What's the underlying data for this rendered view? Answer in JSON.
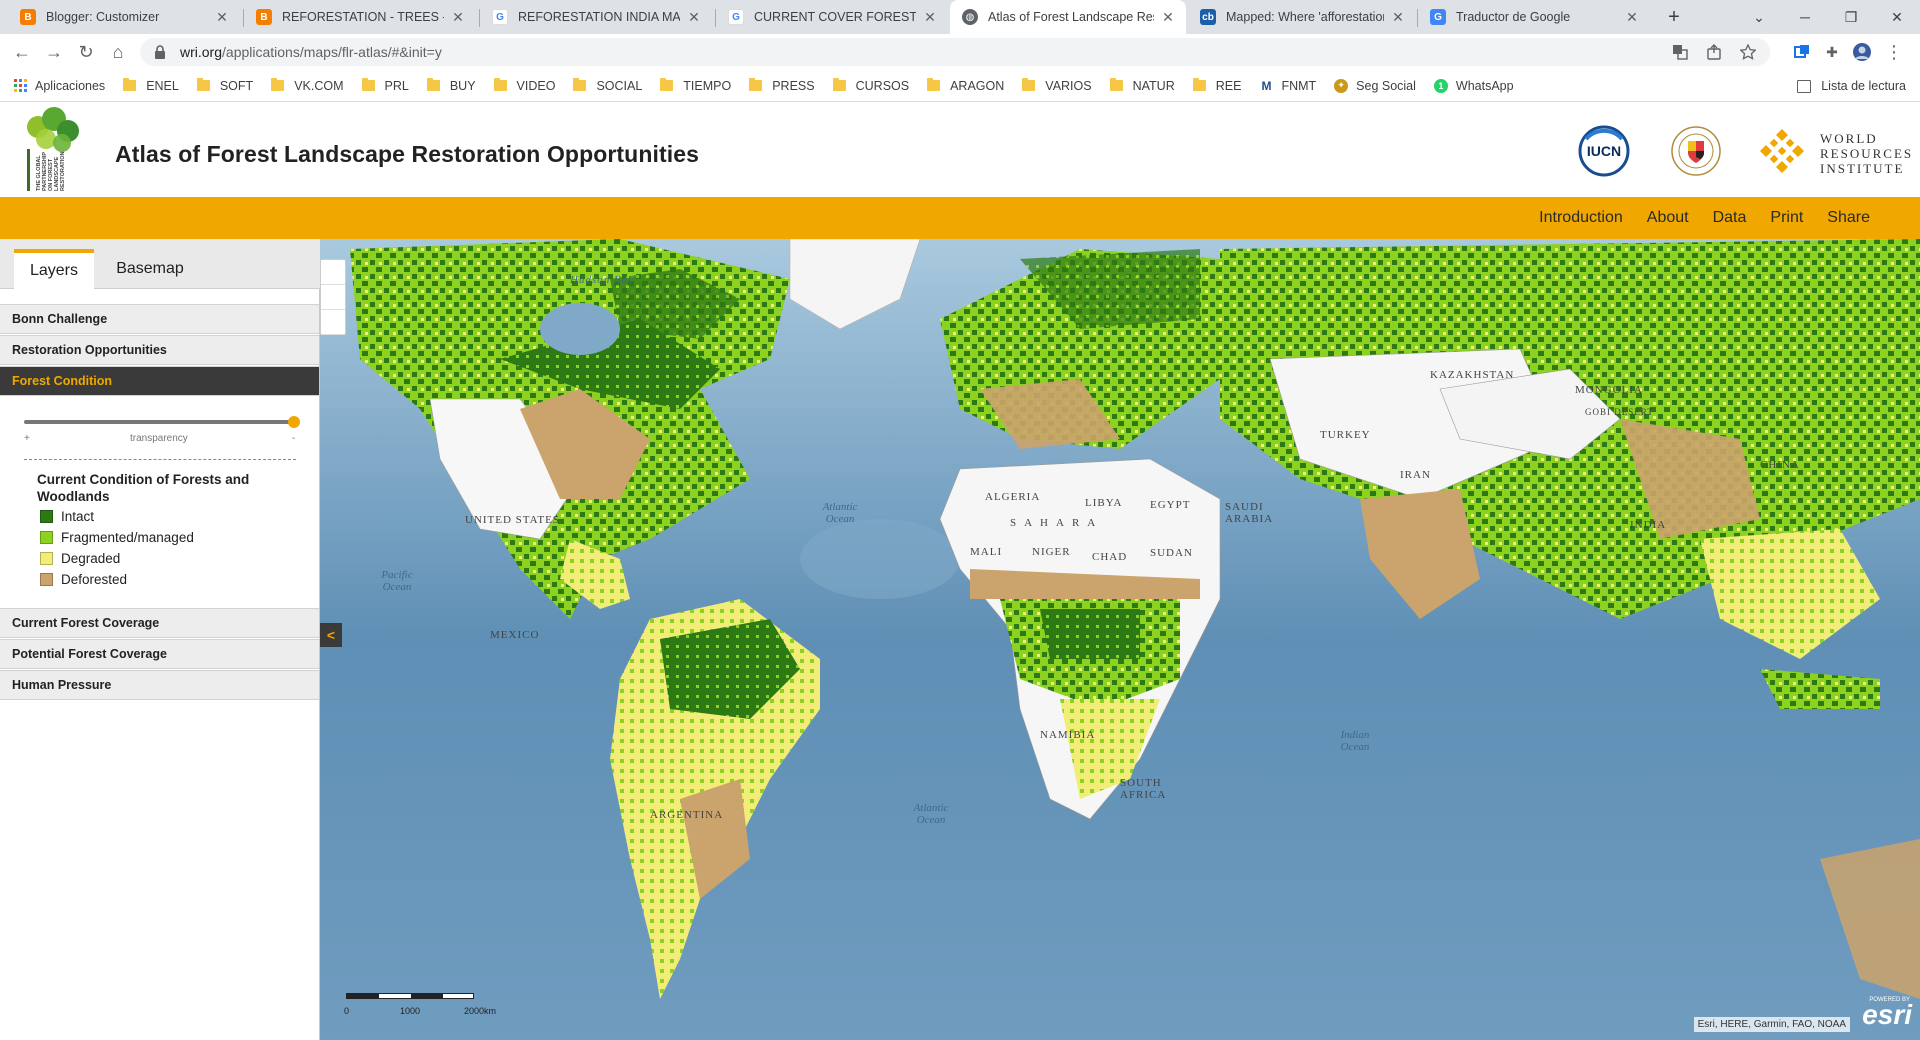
{
  "browser": {
    "tabs": [
      {
        "label": "Blogger: Customizer",
        "icon": "blogger-icon",
        "color": "#f57d00",
        "active": false
      },
      {
        "label": "REFORESTATION - TREES - ARBO",
        "icon": "blogger-icon",
        "color": "#f57d00",
        "active": false
      },
      {
        "label": "REFORESTATION INDIA MAP - Bú",
        "icon": "google-icon",
        "color": "#4285f4",
        "active": false
      },
      {
        "label": "CURRENT COVER FOREST MAP - ",
        "icon": "google-icon",
        "color": "#4285f4",
        "active": false
      },
      {
        "label": "Atlas of Forest Landscape Resto",
        "icon": "globe-icon",
        "color": "#5f6368",
        "active": true
      },
      {
        "label": "Mapped: Where 'afforestation' is",
        "icon": "carbonbrief-icon",
        "color": "#1a5fa8",
        "active": false
      },
      {
        "label": "Traductor de Google",
        "icon": "translate-icon",
        "color": "#4285f4",
        "active": false
      }
    ],
    "url_host": "wri.org",
    "url_path": "/applications/maps/flr-atlas/#&init=y",
    "bookmarks": [
      {
        "label": "Aplicaciones",
        "type": "apps"
      },
      {
        "label": "ENEL",
        "type": "folder"
      },
      {
        "label": "SOFT",
        "type": "folder"
      },
      {
        "label": "VK.COM",
        "type": "folder"
      },
      {
        "label": "PRL",
        "type": "folder"
      },
      {
        "label": "BUY",
        "type": "folder"
      },
      {
        "label": "VIDEO",
        "type": "folder"
      },
      {
        "label": "SOCIAL",
        "type": "folder"
      },
      {
        "label": "TIEMPO",
        "type": "folder"
      },
      {
        "label": "PRESS",
        "type": "folder"
      },
      {
        "label": "CURSOS",
        "type": "folder"
      },
      {
        "label": "ARAGON",
        "type": "folder"
      },
      {
        "label": "VARIOS",
        "type": "folder"
      },
      {
        "label": "NATUR",
        "type": "folder"
      },
      {
        "label": "REE",
        "type": "folder"
      },
      {
        "label": "FNMT",
        "type": "fnmt"
      },
      {
        "label": "Seg Social",
        "type": "segsocial"
      },
      {
        "label": "WhatsApp",
        "type": "whatsapp"
      }
    ],
    "reading_list": "Lista de lectura"
  },
  "site": {
    "title": "Atlas of Forest Landscape Restoration Opportunities",
    "logo_text": "THE GLOBAL PARTNERSHIP ON FOREST LANDSCAPE RESTORATION",
    "partners": {
      "iucn": "IUCN",
      "umd": "UNIVERSITY OF MARYLAND",
      "wri_line1": "WORLD",
      "wri_line2": "RESOURCES",
      "wri_line3": "INSTITUTE"
    },
    "nav": [
      "Introduction",
      "About",
      "Data",
      "Print",
      "Share"
    ],
    "accent": "#f0a700"
  },
  "sidebar": {
    "tabs": [
      "Layers",
      "Basemap"
    ],
    "sections_top": [
      "Bonn Challenge",
      "Restoration Opportunities",
      "Forest Condition"
    ],
    "sections_bottom": [
      "Current Forest Coverage",
      "Potential Forest Coverage",
      "Human Pressure"
    ],
    "slider": {
      "plus": "+",
      "label": "transparency",
      "minus": "-",
      "value": 1.0
    },
    "legend": {
      "title": "Current Condition of Forests and Woodlands",
      "items": [
        {
          "label": "Intact",
          "color": "#2d7a14"
        },
        {
          "label": "Fragmented/managed",
          "color": "#8cd21e"
        },
        {
          "label": "Degraded",
          "color": "#f2ec79"
        },
        {
          "label": "Deforested",
          "color": "#cba36c"
        }
      ]
    },
    "collapse_glyph": "<"
  },
  "map": {
    "countries": [
      "UNITED STATES",
      "MEXICO",
      "KAZAKHSTAN",
      "MONGOLIA",
      "GOBI DESERT",
      "TURKEY",
      "IRAN",
      "ALGERIA",
      "LIBYA",
      "EGYPT",
      "SAUDI ARABIA",
      "SAHARA",
      "MALI",
      "NIGER",
      "CHAD",
      "SUDAN",
      "INDIA",
      "CHINA",
      "NAMIBIA",
      "SOUTH AFRICA",
      "ARGENTINA",
      "Hudson Bay"
    ],
    "oceans": [
      "Atlantic Ocean",
      "Pacific Ocean",
      "Indian Ocean",
      "Atlantic Ocean"
    ],
    "scale": [
      "0",
      "1000",
      "2000km"
    ],
    "attribution": "Esri, HERE, Garmin, FAO, NOAA",
    "esri_powered": "POWERED BY",
    "esri": "esri"
  }
}
